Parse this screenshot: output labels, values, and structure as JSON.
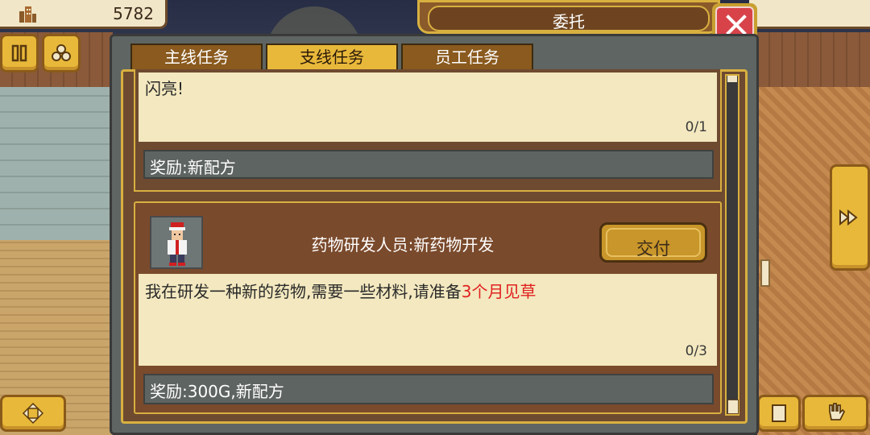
{
  "topbar": {
    "money_icon": "building-icon",
    "money_value": "5782"
  },
  "dialog": {
    "title": "委托",
    "close_icon": "close-icon"
  },
  "tabs": [
    {
      "label": "主线任务",
      "active": false
    },
    {
      "label": "支线任务",
      "active": true
    },
    {
      "label": "员工任务",
      "active": false
    }
  ],
  "quests": [
    {
      "description": "闪亮!",
      "progress": "0/1",
      "reward": "奖励:新配方"
    },
    {
      "giver_icon": "scientist-portrait-icon",
      "title": "药物研发人员:新药物开发",
      "action_label": "交付",
      "description_prefix": "我在研发一种新的药物,需要一些材料,请准备",
      "description_highlight": "3个月见草",
      "progress": "0/3",
      "reward": "奖励:300G,新配方"
    }
  ],
  "colors": {
    "highlight": "#e02020",
    "gold": "#d8b040",
    "close_red": "#d8434a"
  },
  "side_buttons": [
    "pause-icon",
    "social-icon",
    "move-icon",
    "fast-forward-icon",
    "book-icon",
    "hand-icon"
  ]
}
